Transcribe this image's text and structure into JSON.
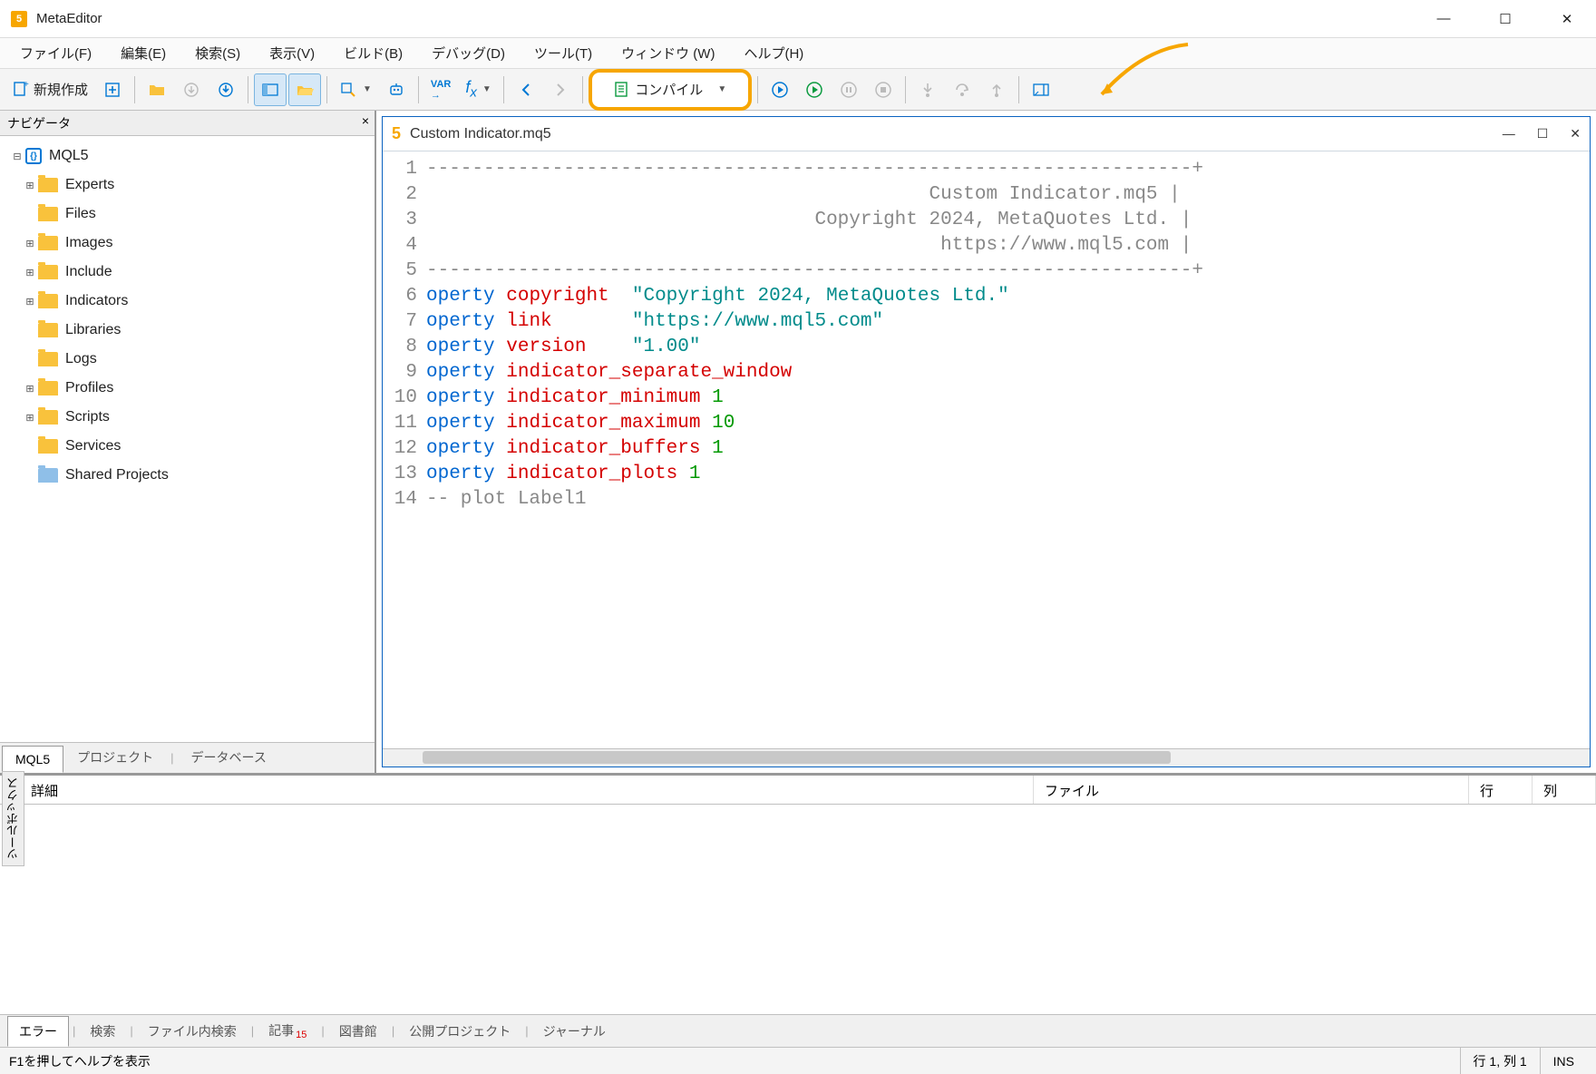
{
  "app": {
    "title": "MetaEditor"
  },
  "menu": {
    "file": "ファイル(F)",
    "edit": "編集(E)",
    "search": "検索(S)",
    "view": "表示(V)",
    "build": "ビルド(B)",
    "debug": "デバッグ(D)",
    "tools": "ツール(T)",
    "window": "ウィンドウ (W)",
    "help": "ヘルプ(H)"
  },
  "toolbar": {
    "new": "新規作成",
    "compile": "コンパイル"
  },
  "navigator": {
    "title": "ナビゲータ",
    "root": "MQL5",
    "items": [
      {
        "label": "Experts",
        "expandable": true
      },
      {
        "label": "Files",
        "expandable": false
      },
      {
        "label": "Images",
        "expandable": true
      },
      {
        "label": "Include",
        "expandable": true
      },
      {
        "label": "Indicators",
        "expandable": true
      },
      {
        "label": "Libraries",
        "expandable": false
      },
      {
        "label": "Logs",
        "expandable": false
      },
      {
        "label": "Profiles",
        "expandable": true
      },
      {
        "label": "Scripts",
        "expandable": true
      },
      {
        "label": "Services",
        "expandable": false
      },
      {
        "label": "Shared Projects",
        "expandable": false,
        "blue": true
      }
    ],
    "tabs": {
      "mql5": "MQL5",
      "project": "プロジェクト",
      "database": "データベース"
    }
  },
  "editor": {
    "filename": "Custom Indicator.mq5",
    "header_comment_name": "Custom Indicator.mq5",
    "header_comment_copy": "Copyright 2024, MetaQuotes Ltd.",
    "header_comment_url": "https://www.mql5.com",
    "props": [
      {
        "kw": "operty",
        "id": "copyright",
        "str": "\"Copyright 2024, MetaQuotes Ltd.\""
      },
      {
        "kw": "operty",
        "id": "link",
        "str": "\"https://www.mql5.com\""
      },
      {
        "kw": "operty",
        "id": "version",
        "str": "\"1.00\""
      },
      {
        "kw": "operty",
        "id": "indicator_separate_window"
      },
      {
        "kw": "operty",
        "id": "indicator_minimum",
        "num": "1"
      },
      {
        "kw": "operty",
        "id": "indicator_maximum",
        "num": "10"
      },
      {
        "kw": "operty",
        "id": "indicator_buffers",
        "num": "1"
      },
      {
        "kw": "operty",
        "id": "indicator_plots",
        "num": "1"
      }
    ],
    "plot_comment": "-- plot Label1"
  },
  "bottom": {
    "cols": {
      "detail": "詳細",
      "file": "ファイル",
      "row": "行",
      "col": "列"
    },
    "tabs": {
      "error": "エラー",
      "search": "検索",
      "findinfiles": "ファイル内検索",
      "articles": "記事",
      "library": "図書館",
      "projects": "公開プロジェクト",
      "journal": "ジャーナル",
      "articles_badge": "15"
    },
    "sidelabel": "ツールボックス"
  },
  "status": {
    "help": "F1を押してヘルプを表示",
    "pos": "行 1, 列 1",
    "ins": "INS"
  }
}
